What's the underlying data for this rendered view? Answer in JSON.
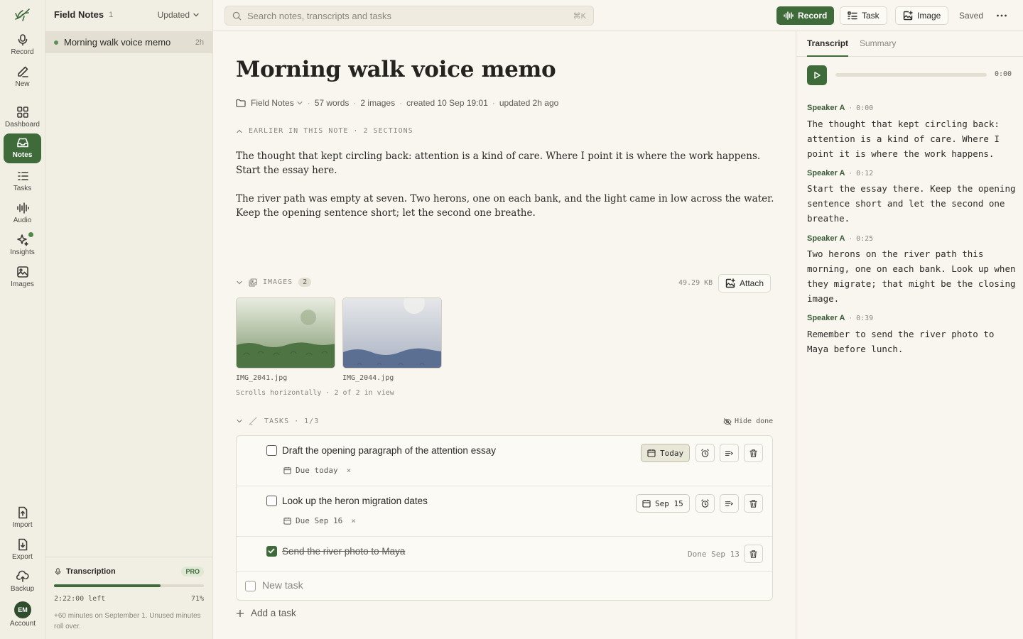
{
  "colors": {
    "accent": "#3f6b3b",
    "background": "#f8f6ef",
    "rail": "#f1eee4",
    "active_row": "#e3e0d3"
  },
  "rail": {
    "items": [
      {
        "label": "Record",
        "icon": "microphone-icon"
      },
      {
        "label": "New",
        "icon": "pencil-icon"
      },
      {
        "label": "Dashboard",
        "icon": "grid-icon"
      },
      {
        "label": "Notes",
        "icon": "inbox-icon",
        "active": true
      },
      {
        "label": "Tasks",
        "icon": "list-icon"
      },
      {
        "label": "Audio",
        "icon": "waveform-icon"
      },
      {
        "label": "Insights",
        "icon": "sparkle-icon"
      },
      {
        "label": "Images",
        "icon": "image-icon"
      },
      {
        "label": "Import",
        "icon": "upload-file-icon"
      },
      {
        "label": "Export",
        "icon": "download-file-icon"
      },
      {
        "label": "Backup",
        "icon": "cloud-upload-icon"
      }
    ],
    "account": {
      "initials": "EM",
      "label": "Account"
    }
  },
  "notes_list": {
    "title": "Field Notes",
    "count": "1",
    "sort_label": "Updated",
    "items": [
      {
        "title": "Morning walk voice memo",
        "age": "2h"
      }
    ]
  },
  "transcription": {
    "label": "Transcription",
    "badge": "PRO",
    "left": "2:22:00 left",
    "percent": "71%",
    "progress": 0.71,
    "note": "+60 minutes on September 1. Unused minutes roll over."
  },
  "topbar": {
    "search_placeholder": "Search notes, transcripts and tasks",
    "shortcut": "⌘K",
    "record_label": "Record",
    "task_label": "Task",
    "image_label": "Image",
    "saved_label": "Saved"
  },
  "note": {
    "title": "Morning walk voice memo",
    "folder": "Field Notes",
    "words": "57 words",
    "images": "2 images",
    "created": "created 10 Sep 19:01",
    "updated": "updated 2h ago",
    "earlier_label": "EARLIER IN THIS NOTE · 2 SECTIONS",
    "paragraphs": [
      "The thought that kept circling back: attention is a kind of care. Where I point it is where the work happens. Start the essay here.",
      "The river path was empty at seven. Two herons, one on each bank, and the light came in low across the water. Keep the opening sentence short; let the second one breathe."
    ]
  },
  "images_section": {
    "label": "IMAGES",
    "count": "2",
    "size": "49.29 KB",
    "attach_label": "Attach",
    "files": [
      {
        "name": "IMG_2041.jpg"
      },
      {
        "name": "IMG_2044.jpg"
      }
    ],
    "scroll_note": "Scrolls horizontally · 2 of 2 in view"
  },
  "tasks_section": {
    "label": "TASKS · 1/3",
    "hide_done_label": "Hide done",
    "new_task_placeholder": "New task",
    "add_task_label": "Add a task",
    "tasks": [
      {
        "text": "Draft the opening paragraph of the attention essay",
        "due": "Due today",
        "chip": "Today",
        "done": false
      },
      {
        "text": "Look up the heron migration dates",
        "due": "Due Sep 16",
        "chip": "Sep 15",
        "done": false
      },
      {
        "text": "Send the river photo to Maya",
        "done_label": "Done Sep 13",
        "done": true
      }
    ]
  },
  "transcript_panel": {
    "tabs": [
      "Transcript",
      "Summary"
    ],
    "time": "0:00",
    "segments": [
      {
        "speaker": "Speaker A",
        "ts": "0:00",
        "text": "The thought that kept circling back: attention is a kind of care. Where I point it is where the work happens."
      },
      {
        "speaker": "Speaker A",
        "ts": "0:12",
        "text": "Start the essay there. Keep the opening sentence short and let the second one breathe."
      },
      {
        "speaker": "Speaker A",
        "ts": "0:25",
        "text": "Two herons on the river path this morning, one on each bank. Look up when they migrate; that might be the closing image."
      },
      {
        "speaker": "Speaker A",
        "ts": "0:39",
        "text": "Remember to send the river photo to Maya before lunch."
      }
    ]
  }
}
